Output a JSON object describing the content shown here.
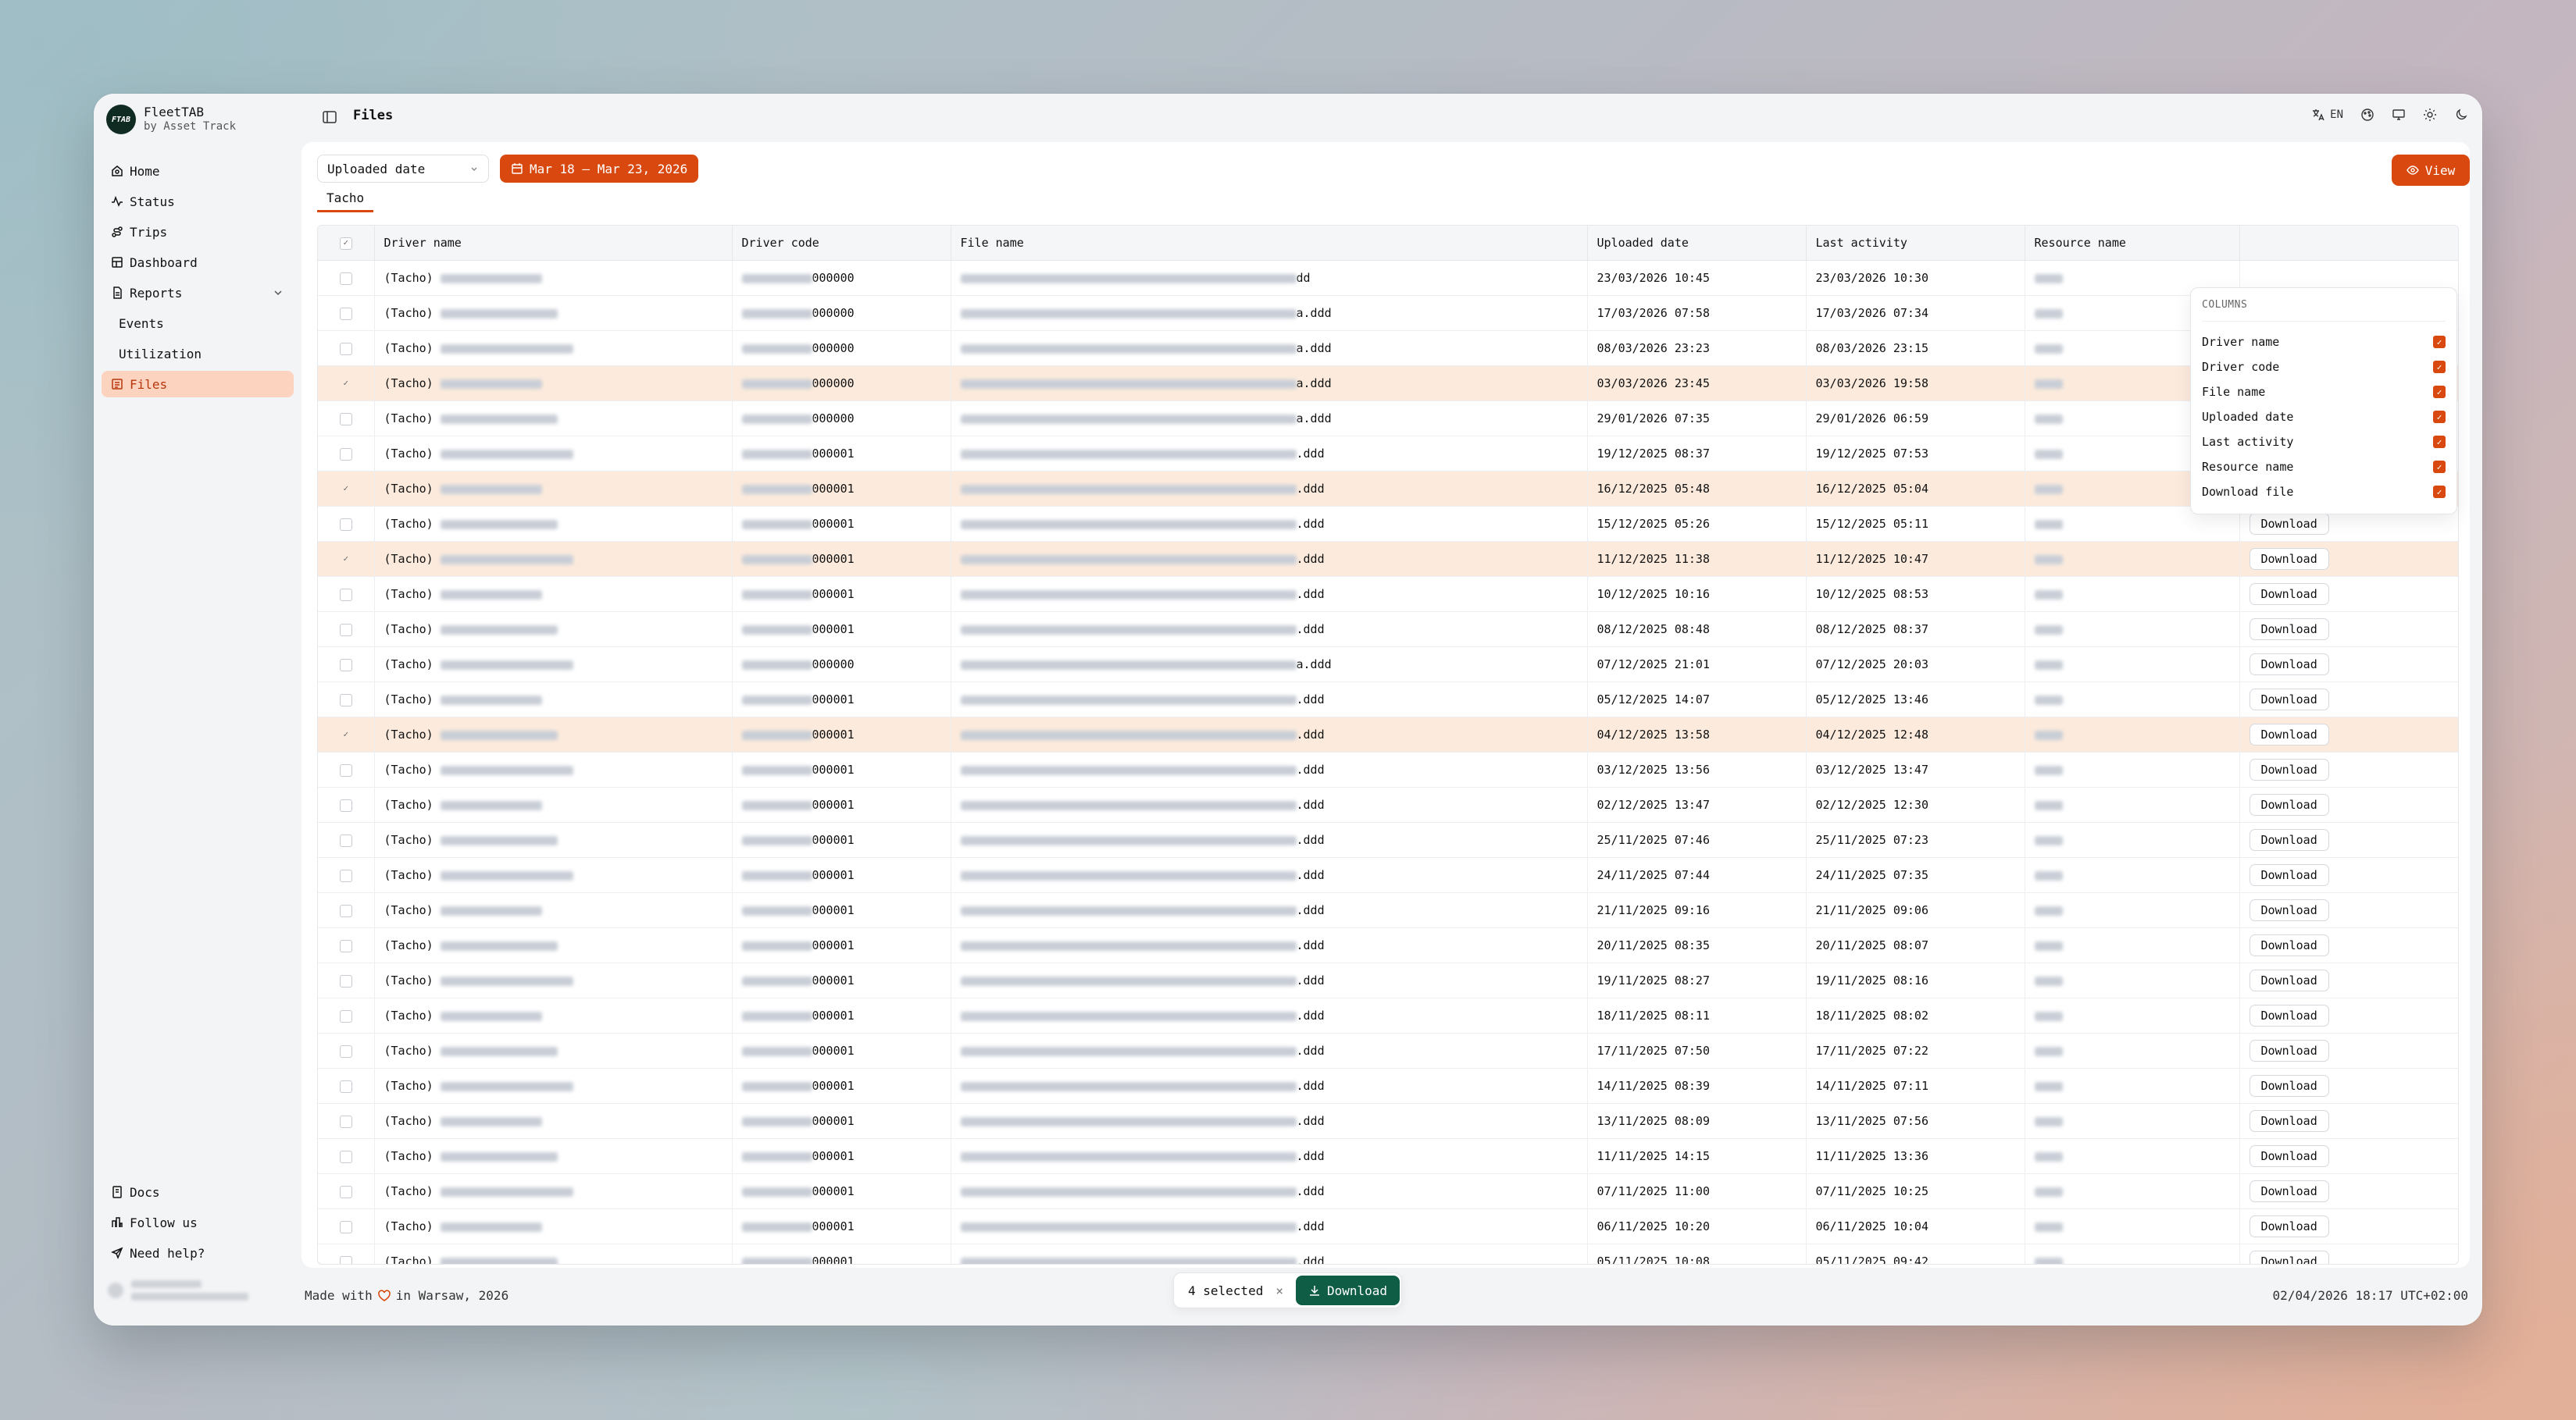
{
  "app": {
    "name": "FleetTAB",
    "subtitle": "by Asset Track",
    "logo_text": "FTAB"
  },
  "sidebar": {
    "items": [
      {
        "label": "Home",
        "icon": "home-icon"
      },
      {
        "label": "Status",
        "icon": "activity-icon"
      },
      {
        "label": "Trips",
        "icon": "route-icon"
      },
      {
        "label": "Dashboard",
        "icon": "dashboard-icon"
      },
      {
        "label": "Reports",
        "icon": "report-icon"
      },
      {
        "label": "Events",
        "icon": ""
      },
      {
        "label": "Utilization",
        "icon": ""
      },
      {
        "label": "Files",
        "icon": "files-icon",
        "active": true
      }
    ],
    "bottom": [
      {
        "label": "Docs",
        "icon": "docs-icon"
      },
      {
        "label": "Follow us",
        "icon": "follow-icon"
      },
      {
        "label": "Need help?",
        "icon": "send-icon"
      }
    ]
  },
  "header": {
    "title": "Files",
    "lang": "EN"
  },
  "filters": {
    "date_field": "Uploaded date",
    "date_range": "Mar 18 – Mar 23, 2026",
    "view_label": "View"
  },
  "tabs": [
    "Tacho"
  ],
  "table": {
    "columns": [
      "Driver name",
      "Driver code",
      "File name",
      "Uploaded date",
      "Last activity",
      "Resource name"
    ],
    "download_label": "Download",
    "rows": [
      {
        "type": "(Tacho)",
        "code": "000000",
        "file": "dd",
        "uploaded": "23/03/2026 10:45",
        "activity": "23/03/2026 10:30",
        "selected": false,
        "dl": false
      },
      {
        "type": "(Tacho)",
        "code": "000000",
        "file": "a.ddd",
        "uploaded": "17/03/2026 07:58",
        "activity": "17/03/2026 07:34",
        "selected": false,
        "dl": false
      },
      {
        "type": "(Tacho)",
        "code": "000000",
        "file": "a.ddd",
        "uploaded": "08/03/2026 23:23",
        "activity": "08/03/2026 23:15",
        "selected": false,
        "dl": false
      },
      {
        "type": "(Tacho)",
        "code": "000000",
        "file": "a.ddd",
        "uploaded": "03/03/2026 23:45",
        "activity": "03/03/2026 19:58",
        "selected": true,
        "dl": false
      },
      {
        "type": "(Tacho)",
        "code": "000000",
        "file": "a.ddd",
        "uploaded": "29/01/2026 07:35",
        "activity": "29/01/2026 06:59",
        "selected": false,
        "dl": true
      },
      {
        "type": "(Tacho)",
        "code": "000001",
        "file": ".ddd",
        "uploaded": "19/12/2025 08:37",
        "activity": "19/12/2025 07:53",
        "selected": false,
        "dl": true
      },
      {
        "type": "(Tacho)",
        "code": "000001",
        "file": ".ddd",
        "uploaded": "16/12/2025 05:48",
        "activity": "16/12/2025 05:04",
        "selected": true,
        "dl": true
      },
      {
        "type": "(Tacho)",
        "code": "000001",
        "file": ".ddd",
        "uploaded": "15/12/2025 05:26",
        "activity": "15/12/2025 05:11",
        "selected": false,
        "dl": true
      },
      {
        "type": "(Tacho)",
        "code": "000001",
        "file": ".ddd",
        "uploaded": "11/12/2025 11:38",
        "activity": "11/12/2025 10:47",
        "selected": true,
        "dl": true
      },
      {
        "type": "(Tacho)",
        "code": "000001",
        "file": ".ddd",
        "uploaded": "10/12/2025 10:16",
        "activity": "10/12/2025 08:53",
        "selected": false,
        "dl": true
      },
      {
        "type": "(Tacho)",
        "code": "000001",
        "file": ".ddd",
        "uploaded": "08/12/2025 08:48",
        "activity": "08/12/2025 08:37",
        "selected": false,
        "dl": true
      },
      {
        "type": "(Tacho)",
        "code": "000000",
        "file": "a.ddd",
        "uploaded": "07/12/2025 21:01",
        "activity": "07/12/2025 20:03",
        "selected": false,
        "dl": true
      },
      {
        "type": "(Tacho)",
        "code": "000001",
        "file": ".ddd",
        "uploaded": "05/12/2025 14:07",
        "activity": "05/12/2025 13:46",
        "selected": false,
        "dl": true
      },
      {
        "type": "(Tacho)",
        "code": "000001",
        "file": ".ddd",
        "uploaded": "04/12/2025 13:58",
        "activity": "04/12/2025 12:48",
        "selected": true,
        "dl": true
      },
      {
        "type": "(Tacho)",
        "code": "000001",
        "file": ".ddd",
        "uploaded": "03/12/2025 13:56",
        "activity": "03/12/2025 13:47",
        "selected": false,
        "dl": true
      },
      {
        "type": "(Tacho)",
        "code": "000001",
        "file": ".ddd",
        "uploaded": "02/12/2025 13:47",
        "activity": "02/12/2025 12:30",
        "selected": false,
        "dl": true
      },
      {
        "type": "(Tacho)",
        "code": "000001",
        "file": ".ddd",
        "uploaded": "25/11/2025 07:46",
        "activity": "25/11/2025 07:23",
        "selected": false,
        "dl": true
      },
      {
        "type": "(Tacho)",
        "code": "000001",
        "file": ".ddd",
        "uploaded": "24/11/2025 07:44",
        "activity": "24/11/2025 07:35",
        "selected": false,
        "dl": true
      },
      {
        "type": "(Tacho)",
        "code": "000001",
        "file": ".ddd",
        "uploaded": "21/11/2025 09:16",
        "activity": "21/11/2025 09:06",
        "selected": false,
        "dl": true
      },
      {
        "type": "(Tacho)",
        "code": "000001",
        "file": ".ddd",
        "uploaded": "20/11/2025 08:35",
        "activity": "20/11/2025 08:07",
        "selected": false,
        "dl": true
      },
      {
        "type": "(Tacho)",
        "code": "000001",
        "file": ".ddd",
        "uploaded": "19/11/2025 08:27",
        "activity": "19/11/2025 08:16",
        "selected": false,
        "dl": true
      },
      {
        "type": "(Tacho)",
        "code": "000001",
        "file": ".ddd",
        "uploaded": "18/11/2025 08:11",
        "activity": "18/11/2025 08:02",
        "selected": false,
        "dl": true
      },
      {
        "type": "(Tacho)",
        "code": "000001",
        "file": ".ddd",
        "uploaded": "17/11/2025 07:50",
        "activity": "17/11/2025 07:22",
        "selected": false,
        "dl": true
      },
      {
        "type": "(Tacho)",
        "code": "000001",
        "file": ".ddd",
        "uploaded": "14/11/2025 08:39",
        "activity": "14/11/2025 07:11",
        "selected": false,
        "dl": true
      },
      {
        "type": "(Tacho)",
        "code": "000001",
        "file": ".ddd",
        "uploaded": "13/11/2025 08:09",
        "activity": "13/11/2025 07:56",
        "selected": false,
        "dl": true
      },
      {
        "type": "(Tacho)",
        "code": "000001",
        "file": ".ddd",
        "uploaded": "11/11/2025 14:15",
        "activity": "11/11/2025 13:36",
        "selected": false,
        "dl": true
      },
      {
        "type": "(Tacho)",
        "code": "000001",
        "file": ".ddd",
        "uploaded": "07/11/2025 11:00",
        "activity": "07/11/2025 10:25",
        "selected": false,
        "dl": true
      },
      {
        "type": "(Tacho)",
        "code": "000001",
        "file": ".ddd",
        "uploaded": "06/11/2025 10:20",
        "activity": "06/11/2025 10:04",
        "selected": false,
        "dl": true
      },
      {
        "type": "(Tacho)",
        "code": "000001",
        "file": ".ddd",
        "uploaded": "05/11/2025 10:08",
        "activity": "05/11/2025 09:42",
        "selected": false,
        "dl": true
      }
    ]
  },
  "columns_menu": {
    "title": "COLUMNS",
    "items": [
      "Driver name",
      "Driver code",
      "File name",
      "Uploaded date",
      "Last activity",
      "Resource name",
      "Download file"
    ]
  },
  "footer": {
    "made_prefix": "Made with",
    "made_suffix": "in Warsaw, 2026",
    "datetime": "02/04/2026 18:17 UTC+02:00"
  },
  "selection": {
    "count_label": "4 selected",
    "download_label": "Download"
  },
  "colors": {
    "accent": "#d9490f",
    "selected_row": "#fcebdd",
    "download_green": "#0f5d45"
  }
}
